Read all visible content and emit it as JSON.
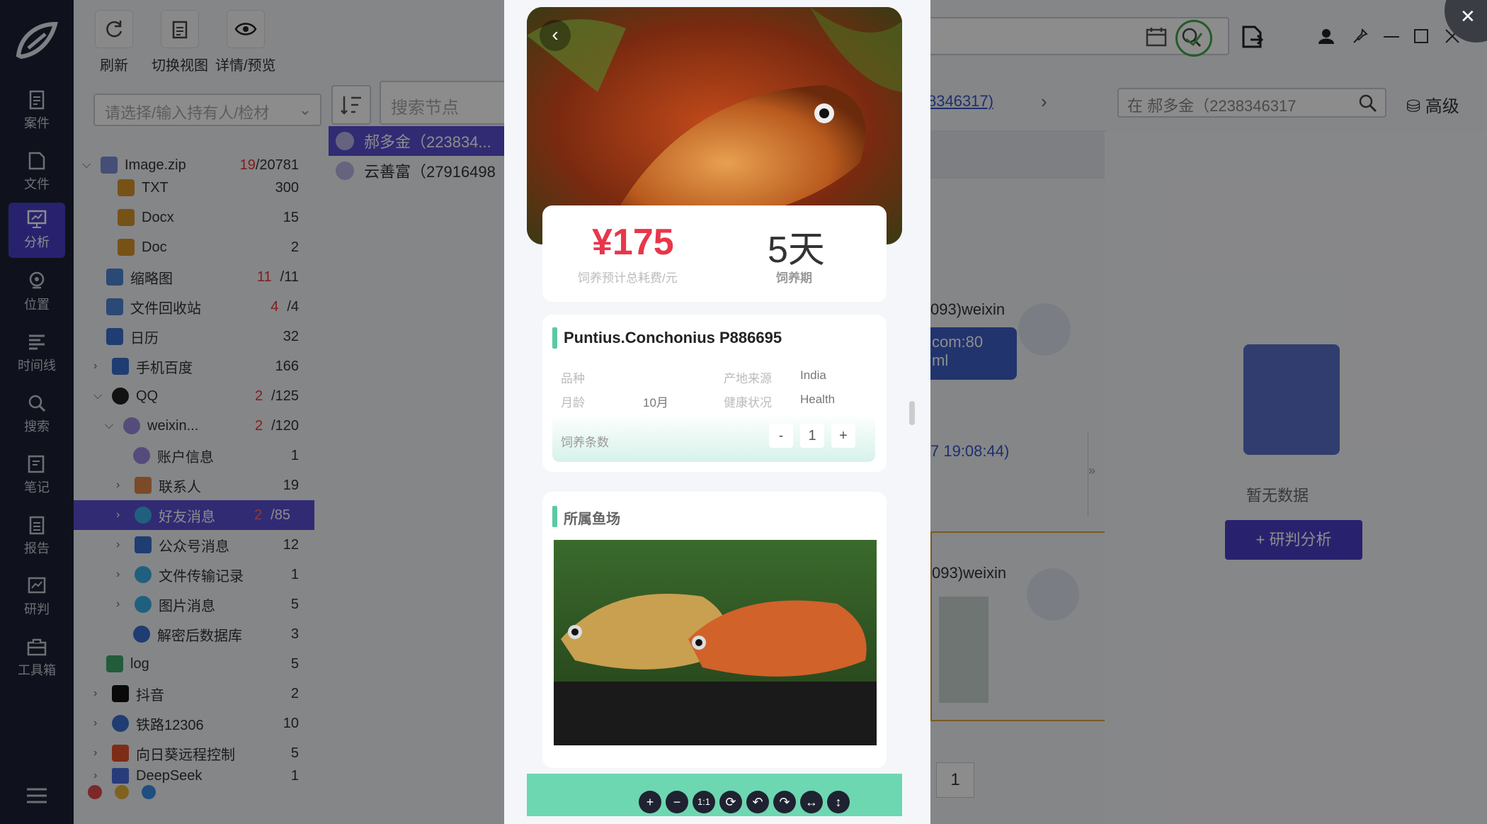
{
  "nav": {
    "items": [
      {
        "label": "案件",
        "icon": "case-icon"
      },
      {
        "label": "文件",
        "icon": "file-icon"
      },
      {
        "label": "分析",
        "icon": "analysis-icon"
      },
      {
        "label": "位置",
        "icon": "location-icon"
      },
      {
        "label": "时间线",
        "icon": "timeline-icon"
      },
      {
        "label": "搜索",
        "icon": "search-icon"
      },
      {
        "label": "笔记",
        "icon": "note-icon"
      },
      {
        "label": "报告",
        "icon": "report-icon"
      },
      {
        "label": "研判",
        "icon": "judge-icon"
      },
      {
        "label": "工具箱",
        "icon": "toolbox-icon"
      }
    ]
  },
  "toolbar": {
    "refresh": "刷新",
    "switch_view": "切换视图",
    "details_preview": "详情/预览"
  },
  "holder_select": {
    "placeholder": "请选择/输入持有人/检材"
  },
  "tree": [
    {
      "label": "Image.zip",
      "red": "19",
      "count": "/20781"
    },
    {
      "label": "TXT",
      "red": "",
      "count": "300"
    },
    {
      "label": "Docx",
      "red": "",
      "count": "15"
    },
    {
      "label": "Doc",
      "red": "",
      "count": "2"
    },
    {
      "label": "缩略图",
      "red": "11",
      "count": "/11"
    },
    {
      "label": "文件回收站",
      "red": "4",
      "count": "/4"
    },
    {
      "label": "日历",
      "red": "",
      "count": "32"
    },
    {
      "label": "手机百度",
      "red": "",
      "count": "166"
    },
    {
      "label": "QQ",
      "red": "2",
      "count": "/125"
    },
    {
      "label": "weixin...",
      "red": "2",
      "count": "/120"
    },
    {
      "label": "账户信息",
      "red": "",
      "count": "1"
    },
    {
      "label": "联系人",
      "red": "",
      "count": "19"
    },
    {
      "label": "好友消息",
      "red": "2",
      "count": "/85"
    },
    {
      "label": "公众号消息",
      "red": "",
      "count": "12"
    },
    {
      "label": "文件传输记录",
      "red": "",
      "count": "1"
    },
    {
      "label": "图片消息",
      "red": "",
      "count": "5"
    },
    {
      "label": "解密后数据库",
      "red": "",
      "count": "3"
    },
    {
      "label": "log",
      "red": "",
      "count": "5"
    },
    {
      "label": "抖音",
      "red": "",
      "count": "2"
    },
    {
      "label": "铁路12306",
      "red": "",
      "count": "10"
    },
    {
      "label": "向日葵远程控制",
      "red": "",
      "count": "5"
    },
    {
      "label": "DeepSeek",
      "red": "",
      "count": "1"
    }
  ],
  "middle": {
    "search_placeholder": "搜索节点",
    "contacts": [
      "郝多金（223834...",
      "云善富（27916498"
    ]
  },
  "right": {
    "breadcrumb": "8346317)",
    "search_value": "在 郝多金（2238346317",
    "advanced": "高级",
    "chat_name_1": "093)weixin",
    "bubble_line1": "com:80",
    "bubble_line2": "ml",
    "time": "7 19:08:44)",
    "chat_name_2": "093)weixin",
    "page": "1",
    "empty": "暂无数据",
    "analyze_btn": "+ 研判分析"
  },
  "viewer": {
    "price": "¥175",
    "price_sub": "饲养预计总耗费/元",
    "days": "5天",
    "days_sub": "饲养期",
    "fish_title": "Puntius.Conchonius  P886695",
    "fields": [
      {
        "k": "品种",
        "v": ""
      },
      {
        "k": "产地来源",
        "v": "India"
      },
      {
        "k": "月龄",
        "v": "10月"
      },
      {
        "k": "健康状况",
        "v": "Health"
      }
    ],
    "quantity_label": "饲养条数",
    "quantity": "1",
    "minus": "-",
    "plus": "+",
    "species_title": "所属鱼场",
    "tools": [
      "+",
      "−",
      "1:1",
      "⟳",
      "↶",
      "↷",
      "↔",
      "↕"
    ]
  },
  "colors": {
    "nav_bg": "#1d2233",
    "accent": "#5a4fd4",
    "price": "#e8364a",
    "teal": "#5bc9a4"
  }
}
